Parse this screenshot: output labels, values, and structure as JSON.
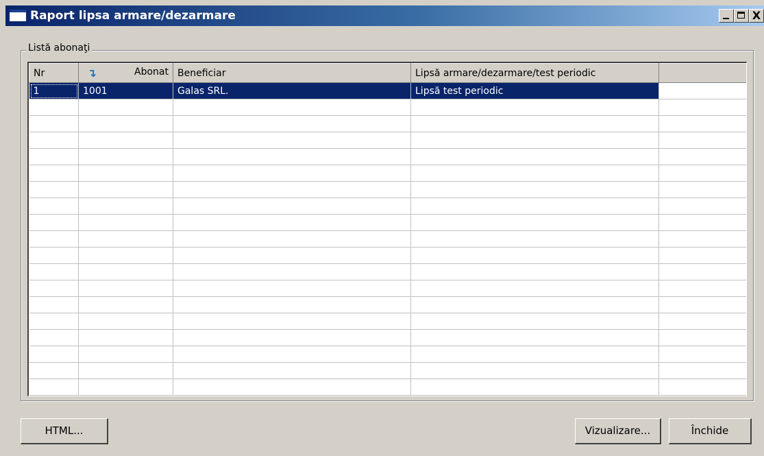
{
  "window": {
    "title": "Raport lipsa armare/dezarmare",
    "close_glyph": "X"
  },
  "group": {
    "label": "Listă abonaţi"
  },
  "table": {
    "columns": [
      "Nr",
      "Abonat",
      "Beneficiar",
      "Lipsă armare/dezarmare/test periodic",
      ""
    ],
    "rows": [
      [
        "1",
        "1001",
        "Galas SRL.",
        "Lipsă test periodic",
        ""
      ]
    ],
    "empty_rows": 18,
    "sort_column_icon": "sort-arrow-icon"
  },
  "buttons": {
    "html": "HTML...",
    "vizualizare": "Vizualizare...",
    "inchide": "Închide"
  },
  "colors": {
    "selection": "#0a246a",
    "face": "#d4d0c8"
  }
}
